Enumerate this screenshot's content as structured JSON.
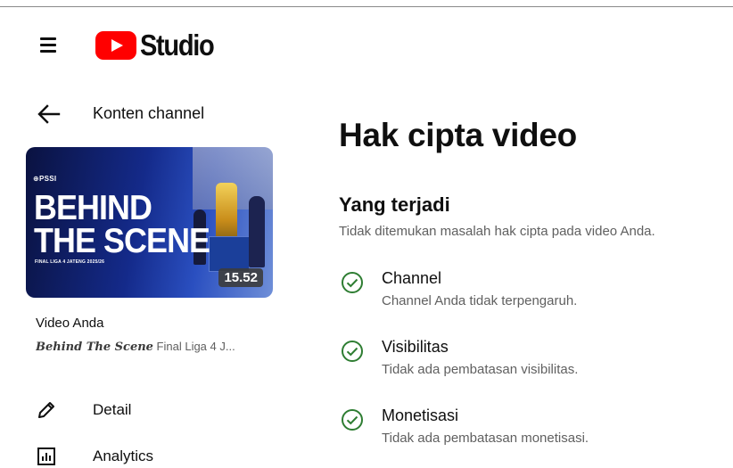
{
  "header": {
    "menu_icon": "hamburger-menu-icon",
    "logo_text": "Studio",
    "brand_color": "#ff0000"
  },
  "nav": {
    "back_label": "Konten channel",
    "video": {
      "section_label": "Video Anda",
      "title_emphasis": "Behind The Scene",
      "title_rest": " Final Liga 4 J...",
      "thumbnail": {
        "brand": "⊕PSSI",
        "headline_line1": "BEHIND",
        "headline_line2": "THE SCENE",
        "subline": "FINAL LIGA 4 JATENG 2025/26",
        "duration": "15.52"
      }
    },
    "items": [
      {
        "label": "Detail",
        "icon": "pencil-icon"
      },
      {
        "label": "Analytics",
        "icon": "analytics-bar-chart-icon"
      }
    ]
  },
  "main": {
    "title": "Hak cipta video",
    "section": {
      "heading": "Yang terjadi",
      "description": "Tidak ditemukan masalah hak cipta pada video Anda."
    },
    "status_items": [
      {
        "title": "Channel",
        "description": "Channel Anda tidak terpengaruh.",
        "icon": "check-circle-icon"
      },
      {
        "title": "Visibilitas",
        "description": "Tidak ada pembatasan visibilitas.",
        "icon": "check-circle-icon"
      },
      {
        "title": "Monetisasi",
        "description": "Tidak ada pembatasan monetisasi.",
        "icon": "check-circle-icon"
      }
    ],
    "status_color": "#2e7d32"
  }
}
